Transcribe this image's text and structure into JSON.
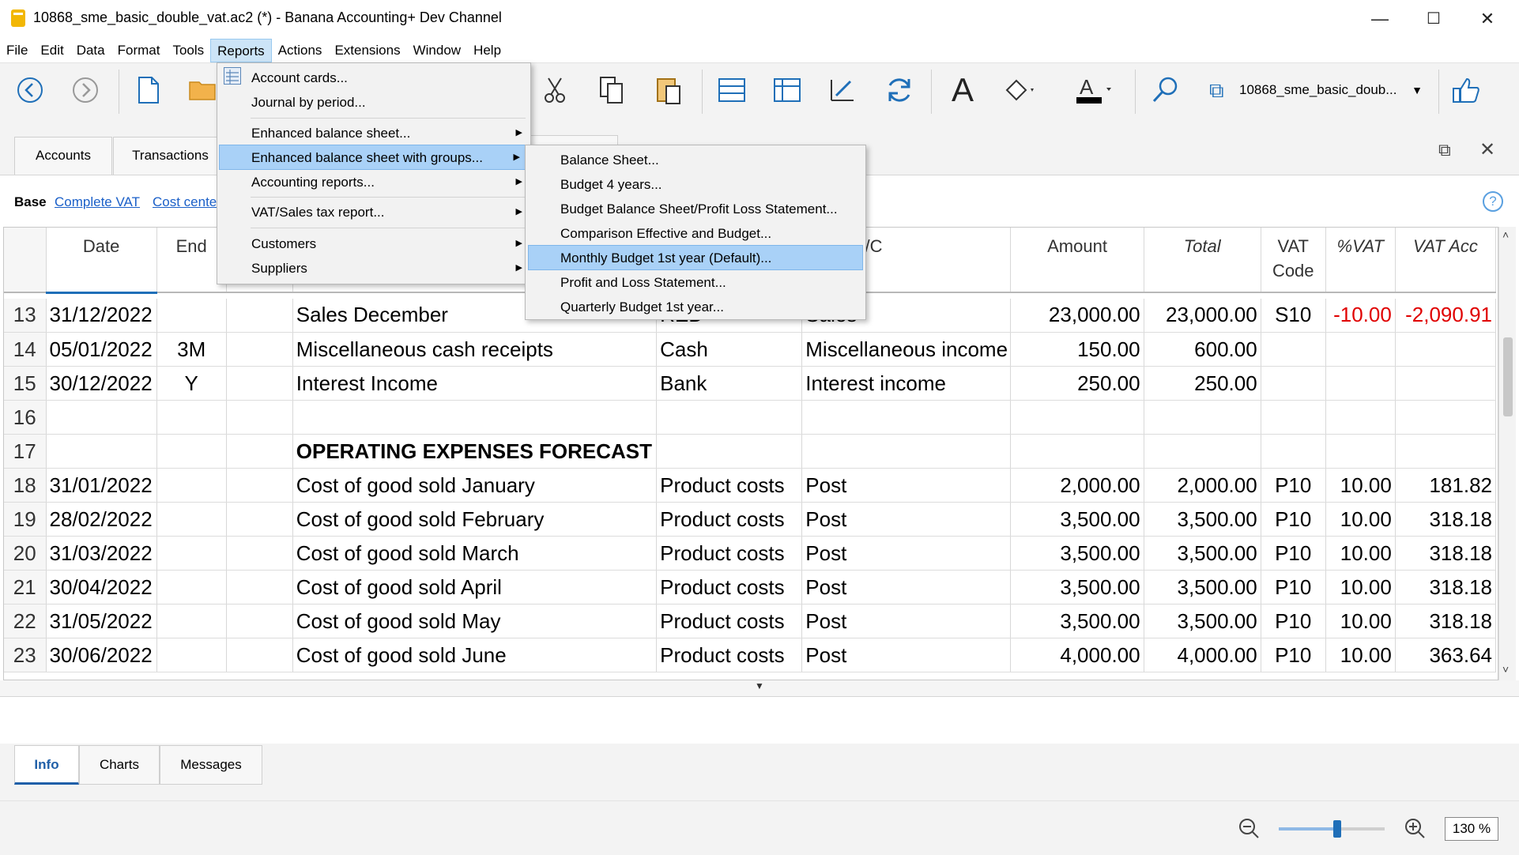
{
  "window": {
    "title": "10868_sme_basic_double_vat.ac2 (*) - Banana Accounting+ Dev Channel",
    "minimize": "—",
    "maximize": "☐",
    "close": "✕"
  },
  "menubar": [
    "File",
    "Edit",
    "Data",
    "Format",
    "Tools",
    "Reports",
    "Actions",
    "Extensions",
    "Window",
    "Help"
  ],
  "toolbar": {
    "file_name": "10868_sme_basic_doub...",
    "icons": [
      "back-icon",
      "forward-icon",
      "new-file-icon",
      "open-folder-icon",
      "cut-icon",
      "copy-icon",
      "paste-icon",
      "insert-rows-icon",
      "add-rows-icon",
      "edit-icon",
      "recalculate-icon",
      "font-icon",
      "fill-color-icon",
      "text-color-icon",
      "search-icon",
      "file-switch-icon",
      "thumbs-up-icon"
    ]
  },
  "doc_tabs": [
    "Accounts",
    "Transactions"
  ],
  "filter": {
    "base": "Base",
    "complete_vat": "Complete VAT",
    "cost_centers": "Cost cente"
  },
  "reports_menu": {
    "items": [
      {
        "label": "Account cards...",
        "submenu": false
      },
      {
        "label": "Journal by period...",
        "submenu": false
      },
      {
        "label": "Enhanced balance sheet...",
        "submenu": true
      },
      {
        "label": "Enhanced balance sheet with groups...",
        "submenu": true,
        "highlighted": true
      },
      {
        "label": "Accounting reports...",
        "submenu": true
      },
      {
        "label": "VAT/Sales tax report...",
        "submenu": true
      },
      {
        "label": "Customers",
        "submenu": true
      },
      {
        "label": "Suppliers",
        "submenu": true
      }
    ]
  },
  "submenu": {
    "items": [
      {
        "label": "Balance Sheet..."
      },
      {
        "label": "Budget 4 years..."
      },
      {
        "label": "Budget Balance Sheet/Profit  Loss Statement..."
      },
      {
        "label": "Comparison Effective and Budget..."
      },
      {
        "label": "Monthly Budget 1st year (Default)...",
        "highlighted": true
      },
      {
        "label": "Profit and Loss Statement..."
      },
      {
        "label": "Quarterly Budget 1st year..."
      }
    ]
  },
  "table": {
    "headers": {
      "date": "Date",
      "end": "End",
      "credit": "Credit A/C",
      "amount": "Amount",
      "total": "Total",
      "vat_code": "VAT Code",
      "pct_vat": "%VAT",
      "vat_acc": "VAT Acc"
    },
    "rows": [
      {
        "no": "13",
        "date": "31/12/2022",
        "end": "",
        "desc": "Sales December",
        "debit": "RED",
        "credit": "Sales",
        "amount": "23,000.00",
        "total": "23,000.00",
        "vat": "S10",
        "pct": "-10.00",
        "vatacc": "-2,090.91",
        "neg": true
      },
      {
        "no": "14",
        "date": "05/01/2022",
        "end": "3M",
        "desc": "Miscellaneous cash receipts",
        "debit": "Cash",
        "credit": "Miscellaneous income",
        "amount": "150.00",
        "total": "600.00",
        "vat": "",
        "pct": "",
        "vatacc": ""
      },
      {
        "no": "15",
        "date": "30/12/2022",
        "end": "Y",
        "desc": "Interest Income",
        "debit": "Bank",
        "credit": "Interest income",
        "amount": "250.00",
        "total": "250.00",
        "vat": "",
        "pct": "",
        "vatacc": ""
      },
      {
        "no": "16",
        "date": "",
        "end": "",
        "desc": "",
        "debit": "",
        "credit": "",
        "amount": "",
        "total": "",
        "vat": "",
        "pct": "",
        "vatacc": ""
      },
      {
        "no": "17",
        "date": "",
        "end": "",
        "desc": "OPERATING EXPENSES FORECAST",
        "debit": "",
        "credit": "",
        "amount": "",
        "total": "",
        "vat": "",
        "pct": "",
        "vatacc": "",
        "bold": true
      },
      {
        "no": "18",
        "date": "31/01/2022",
        "end": "",
        "desc": "Cost of good sold January",
        "debit": "Product costs",
        "credit": "Post",
        "amount": "2,000.00",
        "total": "2,000.00",
        "vat": "P10",
        "pct": "10.00",
        "vatacc": "181.82"
      },
      {
        "no": "19",
        "date": "28/02/2022",
        "end": "",
        "desc": "Cost of good sold February",
        "debit": "Product costs",
        "credit": "Post",
        "amount": "3,500.00",
        "total": "3,500.00",
        "vat": "P10",
        "pct": "10.00",
        "vatacc": "318.18"
      },
      {
        "no": "20",
        "date": "31/03/2022",
        "end": "",
        "desc": "Cost of good sold March",
        "debit": "Product costs",
        "credit": "Post",
        "amount": "3,500.00",
        "total": "3,500.00",
        "vat": "P10",
        "pct": "10.00",
        "vatacc": "318.18"
      },
      {
        "no": "21",
        "date": "30/04/2022",
        "end": "",
        "desc": "Cost of good sold April",
        "debit": "Product costs",
        "credit": "Post",
        "amount": "3,500.00",
        "total": "3,500.00",
        "vat": "P10",
        "pct": "10.00",
        "vatacc": "318.18"
      },
      {
        "no": "22",
        "date": "31/05/2022",
        "end": "",
        "desc": "Cost of good sold May",
        "debit": "Product costs",
        "credit": "Post",
        "amount": "3,500.00",
        "total": "3,500.00",
        "vat": "P10",
        "pct": "10.00",
        "vatacc": "318.18"
      },
      {
        "no": "23",
        "date": "30/06/2022",
        "end": "",
        "desc": "Cost of good sold June",
        "debit": "Product costs",
        "credit": "Post",
        "amount": "4,000.00",
        "total": "4,000.00",
        "vat": "P10",
        "pct": "10.00",
        "vatacc": "363.64"
      }
    ]
  },
  "bottom_tabs": [
    "Info",
    "Charts",
    "Messages"
  ],
  "status": {
    "zoom": "130 %",
    "zoom_level": 0.55
  },
  "colors": {
    "highlight": "#a9d1f7",
    "negative": "#e00000",
    "link": "#1a5fc8",
    "accent_icon": "#1f6fb8"
  }
}
